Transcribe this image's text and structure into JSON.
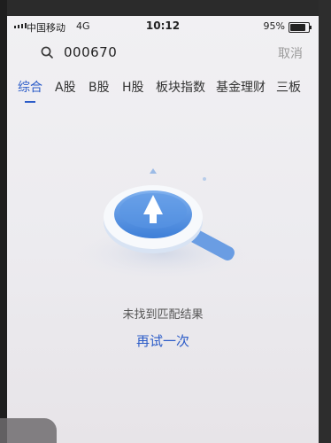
{
  "status": {
    "carrier": "中国移动",
    "network": "4G",
    "time": "10:12",
    "battery": "95%",
    "battery_level": 0.95
  },
  "search": {
    "query": "000670",
    "cancel_label": "取消"
  },
  "tabs": [
    {
      "label": "综合",
      "active": true
    },
    {
      "label": "A股"
    },
    {
      "label": "B股"
    },
    {
      "label": "H股"
    },
    {
      "label": "板块指数"
    },
    {
      "label": "基金理财"
    },
    {
      "label": "三板"
    }
  ],
  "empty_state": {
    "message": "未找到匹配结果",
    "retry_label": "再试一次"
  },
  "colors": {
    "accent": "#2c5cc8"
  }
}
